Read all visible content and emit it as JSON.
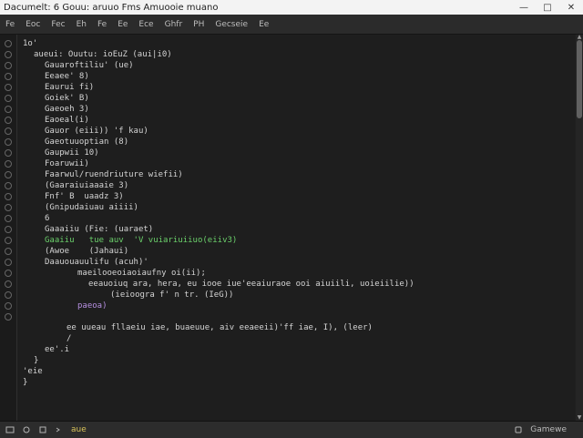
{
  "window": {
    "title": "Dacumelt: 6 Gouu: aruuo  Fms Amuooie muano"
  },
  "menubar": {
    "items": [
      "Fe",
      "Eoc",
      "Fec",
      "Eh",
      "Fe",
      "Ee",
      "Ece",
      "Ghfr",
      "PH",
      "Gecseie",
      "Ee"
    ]
  },
  "editor": {
    "lines": [
      {
        "text": "1o'",
        "indent": 0,
        "color": "#d4d4d4"
      },
      {
        "text": "aueui: Ouutu: ioEuZ (aui|i​0)",
        "indent": 1,
        "color": "#d4d4d4"
      },
      {
        "text": "Gauaroftiliu' (ue)",
        "indent": 2,
        "color": "#d4d4d4"
      },
      {
        "text": "Eeaee' 8)",
        "indent": 2,
        "color": "#d4d4d4"
      },
      {
        "text": "Eaurui fi)",
        "indent": 2,
        "color": "#d4d4d4"
      },
      {
        "text": "Goiek' B)",
        "indent": 2,
        "color": "#d4d4d4"
      },
      {
        "text": "Gaeoeh 3)",
        "indent": 2,
        "color": "#d4d4d4"
      },
      {
        "text": "Eaoeal(i)",
        "indent": 2,
        "color": "#d4d4d4"
      },
      {
        "text": "Gauor (eiii)) 'f kau)",
        "indent": 2,
        "color": "#d4d4d4"
      },
      {
        "text": "Gaeotuuoptian (8)",
        "indent": 2,
        "color": "#d4d4d4"
      },
      {
        "text": "Gaupwii 10)",
        "indent": 2,
        "color": "#d4d4d4"
      },
      {
        "text": "Foaruwii)",
        "indent": 2,
        "color": "#d4d4d4"
      },
      {
        "text": "Faarwul/ruendriuture wiefii)",
        "indent": 2,
        "color": "#d4d4d4"
      },
      {
        "text": "(Gaaraiuiaaaie 3)",
        "indent": 2,
        "color": "#d4d4d4"
      },
      {
        "text": "Fnf' B  uaadz 3)",
        "indent": 2,
        "color": "#d4d4d4"
      },
      {
        "text": "(Gnipudaiuau aiiii)",
        "indent": 2,
        "color": "#d4d4d4"
      },
      {
        "text": "6",
        "indent": 2,
        "color": "#d4d4d4"
      },
      {
        "text": "Gaaaiiu (Fie: (uaraet)",
        "indent": 2,
        "color": "#d4d4d4"
      },
      {
        "text": "Gaaiiu   tue auv  'V vuiariuiiuo(eiiv3)",
        "indent": 2,
        "color": "#6bd06b"
      },
      {
        "text": "(Awoe    (Jahaui)",
        "indent": 2,
        "color": "#d4d4d4"
      },
      {
        "text": "Daauouauulifu (acuh)'",
        "indent": 2,
        "color": "#d4d4d4"
      },
      {
        "text": "maeilooeoiaoiaufny oi(ii);",
        "indent": 5,
        "color": "#d4d4d4"
      },
      {
        "text": "eeauoiuq ara, hera, eu iooe iue'eeaiuraoe ooi aiuiili, uoieiilie))",
        "indent": 6,
        "color": "#d4d4d4"
      },
      {
        "text": "(ieioogra f' n tr. (IeG))",
        "indent": 8,
        "color": "#d4d4d4"
      },
      {
        "text": "paeoa)",
        "indent": 5,
        "color": "#b58fe0"
      },
      {
        "text": "",
        "indent": 0,
        "color": "#d4d4d4"
      },
      {
        "text": "ee uueau fllaeiu iae, buaeuue, aiv eeaeeii)'ff iae, I), (leer)",
        "indent": 4,
        "color": "#d4d4d4"
      },
      {
        "text": "/",
        "indent": 4,
        "color": "#d4d4d4"
      },
      {
        "text": "ee'.i",
        "indent": 2,
        "color": "#d4d4d4"
      },
      {
        "text": "}",
        "indent": 1,
        "color": "#d4d4d4"
      },
      {
        "text": "'eie",
        "indent": 0,
        "color": "#d4d4d4"
      },
      {
        "text": "}",
        "indent": 0,
        "color": "#d4d4d4"
      }
    ]
  },
  "statusbar": {
    "left_label": "aue",
    "icons": [
      "folder-icon",
      "refresh-icon",
      "square-icon",
      "terminal-icon"
    ],
    "right_label": "Gamewe",
    "right_icon": "settings-icon"
  },
  "colors": {
    "background": "#1e1e1e",
    "gutter": "#1b1b1b",
    "menubar": "#2b2b2b",
    "statusbar": "#2c2c2c",
    "accent_yellow": "#d8c25a",
    "accent_green": "#6bd06b",
    "accent_red": "#e06464",
    "accent_purple": "#b58fe0"
  }
}
